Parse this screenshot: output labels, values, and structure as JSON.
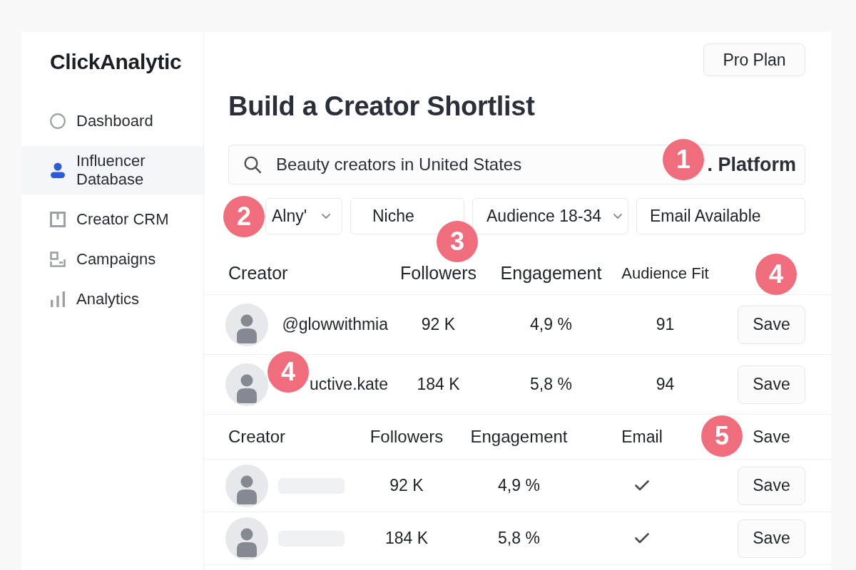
{
  "app": {
    "logo": "ClickAnalytic"
  },
  "sidebar": {
    "items": [
      {
        "label": "Dashboard",
        "selected": false
      },
      {
        "label": "Influencer Database",
        "selected": true
      },
      {
        "label": "Creator CRM",
        "selected": false
      },
      {
        "label": "Campaigns",
        "selected": false
      },
      {
        "label": "Analytics",
        "selected": false
      }
    ]
  },
  "plan_button": "Pro Plan",
  "title": "Build a Creator Shortlist",
  "search": {
    "value": "Beauty creators in United States",
    "platform": ". Platform"
  },
  "filters": [
    {
      "label": "Alny'",
      "kind": "dropdown"
    },
    {
      "label": "Niche",
      "kind": "chip"
    },
    {
      "label": "Audience 18-34",
      "kind": "dropdown"
    },
    {
      "label": "Email Available",
      "kind": "chip"
    }
  ],
  "tables": [
    {
      "columns": [
        "Creator",
        "Followers",
        "Engagement",
        "Audience Fit"
      ],
      "rows": [
        {
          "cells": [
            "@glowwithmia",
            "92 K",
            "4,9 %",
            "91"
          ],
          "action": "Save"
        },
        {
          "cells": [
            "uctive.kate",
            "184 K",
            "5,8 %",
            "94"
          ],
          "action": "Save"
        }
      ]
    },
    {
      "columns": [
        "Creator",
        "Followers",
        "Engagement",
        "Email",
        "Save"
      ],
      "rows": [
        {
          "cells": [
            "",
            "92 K",
            "4,9 %"
          ],
          "email": true,
          "action": "Save"
        },
        {
          "cells": [
            "",
            "184 K",
            "5,8 %"
          ],
          "email": true,
          "action": "Save"
        }
      ]
    }
  ],
  "callouts": [
    "1",
    "2",
    "3",
    "4",
    "4",
    "5"
  ]
}
